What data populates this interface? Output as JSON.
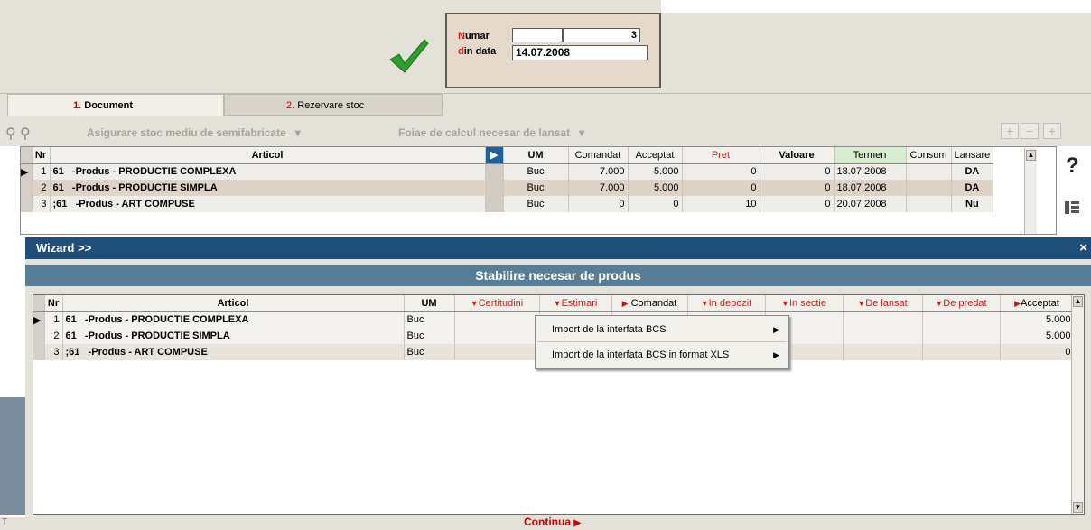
{
  "header": {
    "numar_label_first": "N",
    "numar_label_rest": "umar",
    "numar_value": "3",
    "dindata_label_first": "d",
    "dindata_label_rest": "in data",
    "date_value": "14.07.2008"
  },
  "tabs": [
    {
      "num": "1.",
      "label": "Document"
    },
    {
      "num": "2.",
      "label": "Rezervare stoc"
    }
  ],
  "toolbar": {
    "dropdown1": "Asigurare stoc mediu de semifabricate",
    "dropdown2": "Foiae de calcul necesar de lansat"
  },
  "upper_grid": {
    "headers": [
      "Nr",
      "Articol",
      "UM",
      "Comandat",
      "Acceptat",
      "Pret",
      "Valoare",
      "Termen",
      "Consum",
      "Lansare"
    ],
    "rows": [
      {
        "nr": "1",
        "cod": "61",
        "articol": "-Produs  - PRODUCTIE COMPLEXA",
        "um": "Buc",
        "comandat": "7.000",
        "acceptat": "5.000",
        "pret": "0",
        "valoare": "0",
        "termen": "18.07.2008",
        "consum": "",
        "lansare": "DA"
      },
      {
        "nr": "2",
        "cod": "61",
        "articol": "-Produs  - PRODUCTIE SIMPLA",
        "um": "Buc",
        "comandat": "7.000",
        "acceptat": "5.000",
        "pret": "0",
        "valoare": "0",
        "termen": "18.07.2008",
        "consum": "",
        "lansare": "DA"
      },
      {
        "nr": "3",
        "cod": ";61",
        "articol": "-Produs  - ART COMPUSE",
        "um": "Buc",
        "comandat": "0",
        "acceptat": "0",
        "pret": "10",
        "valoare": "0",
        "termen": "20.07.2008",
        "consum": "",
        "lansare": "Nu"
      }
    ]
  },
  "wizard": {
    "title": "Wizard >>",
    "close": "×",
    "header": "Stabilire necesar de produs",
    "headers": [
      "Nr",
      "Articol",
      "UM",
      "Certitudini",
      "Estimari",
      "Comandat",
      "In depozit",
      "In sectie",
      "De lansat",
      "De predat",
      "Acceptat"
    ],
    "rows": [
      {
        "nr": "1",
        "cod": "61",
        "articol": "-Produs  - PRODUCTIE COMPLEXA",
        "um": "Buc",
        "acceptat": "5.000"
      },
      {
        "nr": "2",
        "cod": "61",
        "articol": "-Produs  - PRODUCTIE SIMPLA",
        "um": "Buc",
        "acceptat": "5.000"
      },
      {
        "nr": "3",
        "cod": ";61",
        "articol": "-Produs  - ART COMPUSE",
        "um": "Buc",
        "acceptat": "0"
      }
    ],
    "context_menu": [
      "Import de la interfata BCS",
      "Import de la interfata BCS in format XLS"
    ],
    "continue_label": "Continua"
  },
  "colors": {
    "titlebar": "#1f4f79",
    "section_header": "#587e97",
    "accent_red": "#d01c1c",
    "check_green": "#2e9e2e"
  },
  "icons": [
    "check-icon",
    "zoom-icon",
    "add-icon",
    "remove-icon",
    "help-icon",
    "grid-icon",
    "close-icon"
  ]
}
